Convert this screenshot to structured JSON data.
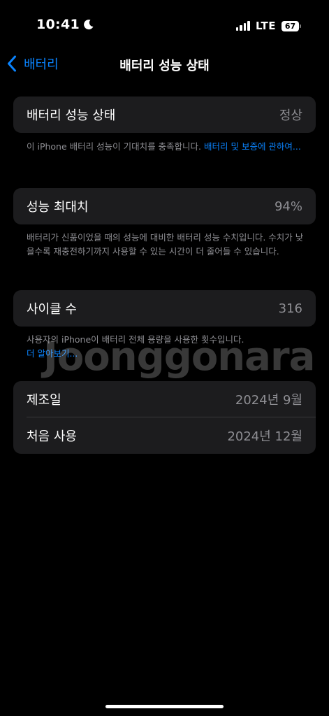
{
  "status_bar": {
    "time": "10:41",
    "moon_icon": "moon-icon",
    "network": "LTE",
    "battery_percent": "67"
  },
  "nav": {
    "back_label": "배터리",
    "title": "배터리 성능 상태"
  },
  "health": {
    "label": "배터리 성능 상태",
    "value": "정상",
    "footnote_text": "이 iPhone 배터리 성능이 기대치를 충족합니다. ",
    "footnote_link": "배터리 및 보증에 관하여..."
  },
  "max_capacity": {
    "label": "성능 최대치",
    "value": "94%",
    "footnote": "배터리가 신품이었을 때의 성능에 대비한 배터리 성능 수치입니다. 수치가 낮을수록 재충전하기까지 사용할 수 있는 시간이 더 줄어들 수 있습니다."
  },
  "cycle_count": {
    "label": "사이클 수",
    "value": "316",
    "footnote_text": "사용자의 iPhone이 배터리 전체 용량을 사용한 횟수입니다.",
    "footnote_link": "더 알아보기..."
  },
  "dates": {
    "manufacture_label": "제조일",
    "manufacture_value": "2024년 9월",
    "first_use_label": "처음 사용",
    "first_use_value": "2024년 12월"
  },
  "watermark": "Joonggonara",
  "colors": {
    "background": "#000000",
    "card": "#1c1c1e",
    "accent": "#0a84ff",
    "secondary_text": "#8e8e93"
  }
}
